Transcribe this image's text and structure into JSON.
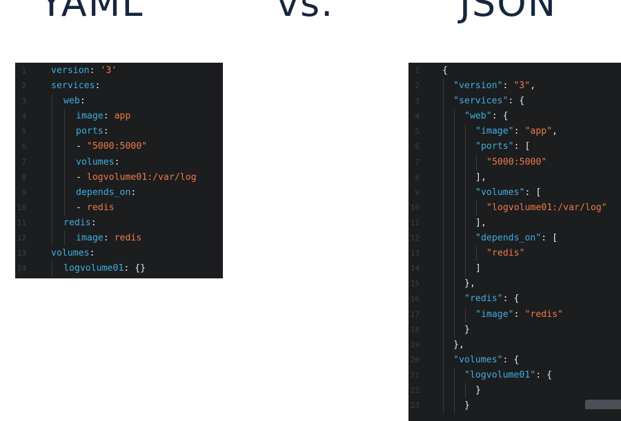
{
  "headings": {
    "left": "YAML",
    "middle": "vs.",
    "right": "JSON"
  },
  "colors": {
    "heading": "#16263d",
    "panel_bg": "#1c1d1f",
    "key": "#3fb0e0",
    "string": "#ee7b47",
    "punctuation": "#e8e8e8",
    "line_number": "#3d4045"
  },
  "yaml": {
    "lines": [
      {
        "n": "1",
        "indent": 0,
        "tokens": [
          [
            "key",
            "version"
          ],
          [
            "pun",
            ": "
          ],
          [
            "str",
            "'3'"
          ]
        ]
      },
      {
        "n": "2",
        "indent": 0,
        "tokens": [
          [
            "key",
            "services"
          ],
          [
            "pun",
            ":"
          ]
        ]
      },
      {
        "n": "3",
        "indent": 1,
        "tokens": [
          [
            "key",
            "web"
          ],
          [
            "pun",
            ":"
          ]
        ]
      },
      {
        "n": "4",
        "indent": 2,
        "tokens": [
          [
            "key",
            "image"
          ],
          [
            "pun",
            ": "
          ],
          [
            "str",
            "app"
          ]
        ]
      },
      {
        "n": "5",
        "indent": 2,
        "tokens": [
          [
            "key",
            "ports"
          ],
          [
            "pun",
            ":"
          ]
        ]
      },
      {
        "n": "6",
        "indent": 2,
        "tokens": [
          [
            "pun",
            "- "
          ],
          [
            "str",
            "\"5000:5000\""
          ]
        ]
      },
      {
        "n": "7",
        "indent": 2,
        "tokens": [
          [
            "key",
            "volumes"
          ],
          [
            "pun",
            ":"
          ]
        ]
      },
      {
        "n": "8",
        "indent": 2,
        "tokens": [
          [
            "pun",
            "- "
          ],
          [
            "str",
            "logvolume01:/var/log"
          ]
        ]
      },
      {
        "n": "9",
        "indent": 2,
        "tokens": [
          [
            "key",
            "depends_on"
          ],
          [
            "pun",
            ":"
          ]
        ]
      },
      {
        "n": "10",
        "indent": 2,
        "tokens": [
          [
            "pun",
            "- "
          ],
          [
            "str",
            "redis"
          ]
        ]
      },
      {
        "n": "11",
        "indent": 1,
        "tokens": [
          [
            "key",
            "redis"
          ],
          [
            "pun",
            ":"
          ]
        ]
      },
      {
        "n": "12",
        "indent": 2,
        "tokens": [
          [
            "key",
            "image"
          ],
          [
            "pun",
            ": "
          ],
          [
            "str",
            "redis"
          ]
        ]
      },
      {
        "n": "13",
        "indent": 0,
        "tokens": [
          [
            "key",
            "volumes"
          ],
          [
            "pun",
            ":"
          ]
        ]
      },
      {
        "n": "14",
        "indent": 1,
        "tokens": [
          [
            "key",
            "logvolume01"
          ],
          [
            "pun",
            ": {}"
          ]
        ]
      }
    ]
  },
  "json": {
    "lines": [
      {
        "n": "1",
        "indent": 0,
        "tokens": [
          [
            "pun",
            "{"
          ]
        ]
      },
      {
        "n": "2",
        "indent": 1,
        "tokens": [
          [
            "key",
            "\"version\""
          ],
          [
            "pun",
            ": "
          ],
          [
            "str",
            "\"3\""
          ],
          [
            "pun",
            ","
          ]
        ]
      },
      {
        "n": "3",
        "indent": 1,
        "tokens": [
          [
            "key",
            "\"services\""
          ],
          [
            "pun",
            ": {"
          ]
        ]
      },
      {
        "n": "4",
        "indent": 2,
        "tokens": [
          [
            "key",
            "\"web\""
          ],
          [
            "pun",
            ": {"
          ]
        ]
      },
      {
        "n": "5",
        "indent": 3,
        "tokens": [
          [
            "key",
            "\"image\""
          ],
          [
            "pun",
            ": "
          ],
          [
            "str",
            "\"app\""
          ],
          [
            "pun",
            ","
          ]
        ]
      },
      {
        "n": "6",
        "indent": 3,
        "tokens": [
          [
            "key",
            "\"ports\""
          ],
          [
            "pun",
            ": ["
          ]
        ]
      },
      {
        "n": "7",
        "indent": 4,
        "tokens": [
          [
            "str",
            "\"5000:5000\""
          ]
        ]
      },
      {
        "n": "8",
        "indent": 3,
        "tokens": [
          [
            "pun",
            "],"
          ]
        ]
      },
      {
        "n": "9",
        "indent": 3,
        "tokens": [
          [
            "key",
            "\"volumes\""
          ],
          [
            "pun",
            ": ["
          ]
        ]
      },
      {
        "n": "10",
        "indent": 4,
        "tokens": [
          [
            "str",
            "\"logvolume01:/var/log\""
          ]
        ]
      },
      {
        "n": "11",
        "indent": 3,
        "tokens": [
          [
            "pun",
            "],"
          ]
        ]
      },
      {
        "n": "12",
        "indent": 3,
        "tokens": [
          [
            "key",
            "\"depends_on\""
          ],
          [
            "pun",
            ": ["
          ]
        ]
      },
      {
        "n": "13",
        "indent": 4,
        "tokens": [
          [
            "str",
            "\"redis\""
          ]
        ]
      },
      {
        "n": "14",
        "indent": 3,
        "tokens": [
          [
            "pun",
            "]"
          ]
        ]
      },
      {
        "n": "15",
        "indent": 2,
        "tokens": [
          [
            "pun",
            "},"
          ]
        ]
      },
      {
        "n": "16",
        "indent": 2,
        "tokens": [
          [
            "key",
            "\"redis\""
          ],
          [
            "pun",
            ": {"
          ]
        ]
      },
      {
        "n": "17",
        "indent": 3,
        "tokens": [
          [
            "key",
            "\"image\""
          ],
          [
            "pun",
            ": "
          ],
          [
            "str",
            "\"redis\""
          ]
        ]
      },
      {
        "n": "18",
        "indent": 2,
        "tokens": [
          [
            "pun",
            "}"
          ]
        ]
      },
      {
        "n": "19",
        "indent": 1,
        "tokens": [
          [
            "pun",
            "},"
          ]
        ]
      },
      {
        "n": "20",
        "indent": 1,
        "tokens": [
          [
            "key",
            "\"volumes\""
          ],
          [
            "pun",
            ": {"
          ]
        ]
      },
      {
        "n": "21",
        "indent": 2,
        "tokens": [
          [
            "key",
            "\"logvolume01\""
          ],
          [
            "pun",
            ": {"
          ]
        ]
      },
      {
        "n": "22",
        "indent": 3,
        "tokens": [
          [
            "pun",
            "}"
          ]
        ]
      },
      {
        "n": "23",
        "indent": 2,
        "tokens": [
          [
            "pun",
            "}"
          ]
        ]
      }
    ]
  }
}
